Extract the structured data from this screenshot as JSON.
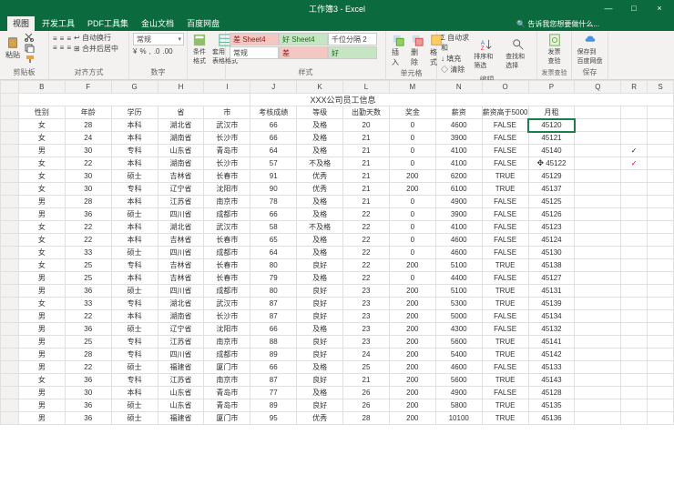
{
  "window": {
    "title": "工作簿3 - Excel",
    "min": "—",
    "max": "□",
    "close": "×"
  },
  "tabs": {
    "items": [
      "视图",
      "开发工具",
      "PDF工具集",
      "金山文档",
      "百度网盘"
    ],
    "active": 0,
    "tell": "🔍 告诉我您想要做什么..."
  },
  "ribbon": {
    "clipboard": {
      "paste": "粘贴",
      "label": "剪贴板"
    },
    "align": {
      "wrap": "自动换行",
      "merge": "合并后居中",
      "label": "对齐方式"
    },
    "number": {
      "fmt": "常规",
      "label": "数字"
    },
    "cond": {
      "l1": "条件格式",
      "l2": "套用\n表格格式",
      "label": ""
    },
    "styles": {
      "r1": [
        "差 Sheet4",
        "好 Sheet4",
        "千位分隔 2"
      ],
      "r2": [
        "常规",
        "差",
        "好"
      ],
      "label": "样式"
    },
    "cells": {
      "ins": "插入",
      "del": "删除",
      "fmt": "格式",
      "label": "单元格"
    },
    "editing": {
      "sum": "自动求和",
      "fill": "填充",
      "clear": "清除",
      "sort": "排序和筛选",
      "find": "查找和选择",
      "label": "编辑"
    },
    "addins": {
      "g1": "发票\n查验",
      "g2": "保存到\n百度网盘",
      "l1": "发票查验",
      "l2": "保存"
    }
  },
  "colHeaders": [
    "",
    "B",
    "F",
    "G",
    "H",
    "I",
    "J",
    "K",
    "L",
    "M",
    "N",
    "O",
    "P",
    "Q",
    "R",
    "S"
  ],
  "titleRow": "XXX公司员工信息",
  "headers": [
    "性别",
    "年龄",
    "学历",
    "省",
    "市",
    "考核成绩",
    "等级",
    "出勤天数",
    "奖金",
    "薪资",
    "薪资高于5000",
    "月租"
  ],
  "rows": [
    [
      "女",
      "28",
      "本科",
      "湖北省",
      "武汉市",
      "66",
      "及格",
      "20",
      "0",
      "4600",
      "FALSE",
      "45120"
    ],
    [
      "女",
      "24",
      "本科",
      "湖南省",
      "长沙市",
      "66",
      "及格",
      "21",
      "0",
      "3900",
      "FALSE",
      "45121"
    ],
    [
      "男",
      "30",
      "专科",
      "山东省",
      "青岛市",
      "64",
      "及格",
      "21",
      "0",
      "4100",
      "FALSE",
      "45140"
    ],
    [
      "女",
      "22",
      "本科",
      "湖南省",
      "长沙市",
      "57",
      "不及格",
      "21",
      "0",
      "4100",
      "FALSE",
      "45122"
    ],
    [
      "女",
      "30",
      "硕士",
      "吉林省",
      "长春市",
      "91",
      "优秀",
      "21",
      "200",
      "6200",
      "TRUE",
      "45129"
    ],
    [
      "女",
      "30",
      "专科",
      "辽宁省",
      "沈阳市",
      "90",
      "优秀",
      "21",
      "200",
      "6100",
      "TRUE",
      "45137"
    ],
    [
      "男",
      "28",
      "本科",
      "江苏省",
      "南京市",
      "78",
      "及格",
      "21",
      "0",
      "4900",
      "FALSE",
      "45125"
    ],
    [
      "男",
      "36",
      "硕士",
      "四川省",
      "成都市",
      "66",
      "及格",
      "22",
      "0",
      "3900",
      "FALSE",
      "45126"
    ],
    [
      "女",
      "22",
      "本科",
      "湖北省",
      "武汉市",
      "58",
      "不及格",
      "22",
      "0",
      "4100",
      "FALSE",
      "45123"
    ],
    [
      "女",
      "22",
      "本科",
      "吉林省",
      "长春市",
      "65",
      "及格",
      "22",
      "0",
      "4600",
      "FALSE",
      "45124"
    ],
    [
      "女",
      "33",
      "硕士",
      "四川省",
      "成都市",
      "64",
      "及格",
      "22",
      "0",
      "4600",
      "FALSE",
      "45130"
    ],
    [
      "女",
      "25",
      "专科",
      "吉林省",
      "长春市",
      "80",
      "良好",
      "22",
      "200",
      "5100",
      "TRUE",
      "45138"
    ],
    [
      "男",
      "25",
      "本科",
      "吉林省",
      "长春市",
      "79",
      "及格",
      "22",
      "0",
      "4400",
      "FALSE",
      "45127"
    ],
    [
      "男",
      "36",
      "硕士",
      "四川省",
      "成都市",
      "80",
      "良好",
      "23",
      "200",
      "5100",
      "TRUE",
      "45131"
    ],
    [
      "女",
      "33",
      "专科",
      "湖北省",
      "武汉市",
      "87",
      "良好",
      "23",
      "200",
      "5300",
      "TRUE",
      "45139"
    ],
    [
      "男",
      "22",
      "本科",
      "湖南省",
      "长沙市",
      "87",
      "良好",
      "23",
      "200",
      "5000",
      "FALSE",
      "45134"
    ],
    [
      "男",
      "36",
      "硕士",
      "辽宁省",
      "沈阳市",
      "66",
      "及格",
      "23",
      "200",
      "4300",
      "FALSE",
      "45132"
    ],
    [
      "男",
      "25",
      "专科",
      "江苏省",
      "南京市",
      "88",
      "良好",
      "23",
      "200",
      "5600",
      "TRUE",
      "45141"
    ],
    [
      "男",
      "28",
      "专科",
      "四川省",
      "成都市",
      "89",
      "良好",
      "24",
      "200",
      "5400",
      "TRUE",
      "45142"
    ],
    [
      "男",
      "22",
      "硕士",
      "福建省",
      "厦门市",
      "66",
      "及格",
      "25",
      "200",
      "4600",
      "FALSE",
      "45133"
    ],
    [
      "女",
      "36",
      "专科",
      "江苏省",
      "南京市",
      "87",
      "良好",
      "21",
      "200",
      "5600",
      "TRUE",
      "45143"
    ],
    [
      "男",
      "30",
      "本科",
      "山东省",
      "青岛市",
      "77",
      "及格",
      "26",
      "200",
      "4900",
      "FALSE",
      "45128"
    ],
    [
      "男",
      "36",
      "硕士",
      "山东省",
      "青岛市",
      "89",
      "良好",
      "26",
      "200",
      "5800",
      "TRUE",
      "45135"
    ],
    [
      "男",
      "36",
      "硕士",
      "福建省",
      "厦门市",
      "95",
      "优秀",
      "28",
      "200",
      "10100",
      "TRUE",
      "45136"
    ]
  ],
  "marks": {
    "row2": "✓",
    "row3": "✓"
  },
  "selectedCell": {
    "row": 0,
    "col": 11
  },
  "cursorCell": {
    "row": 3,
    "col": 11,
    "glyph": "✥"
  }
}
